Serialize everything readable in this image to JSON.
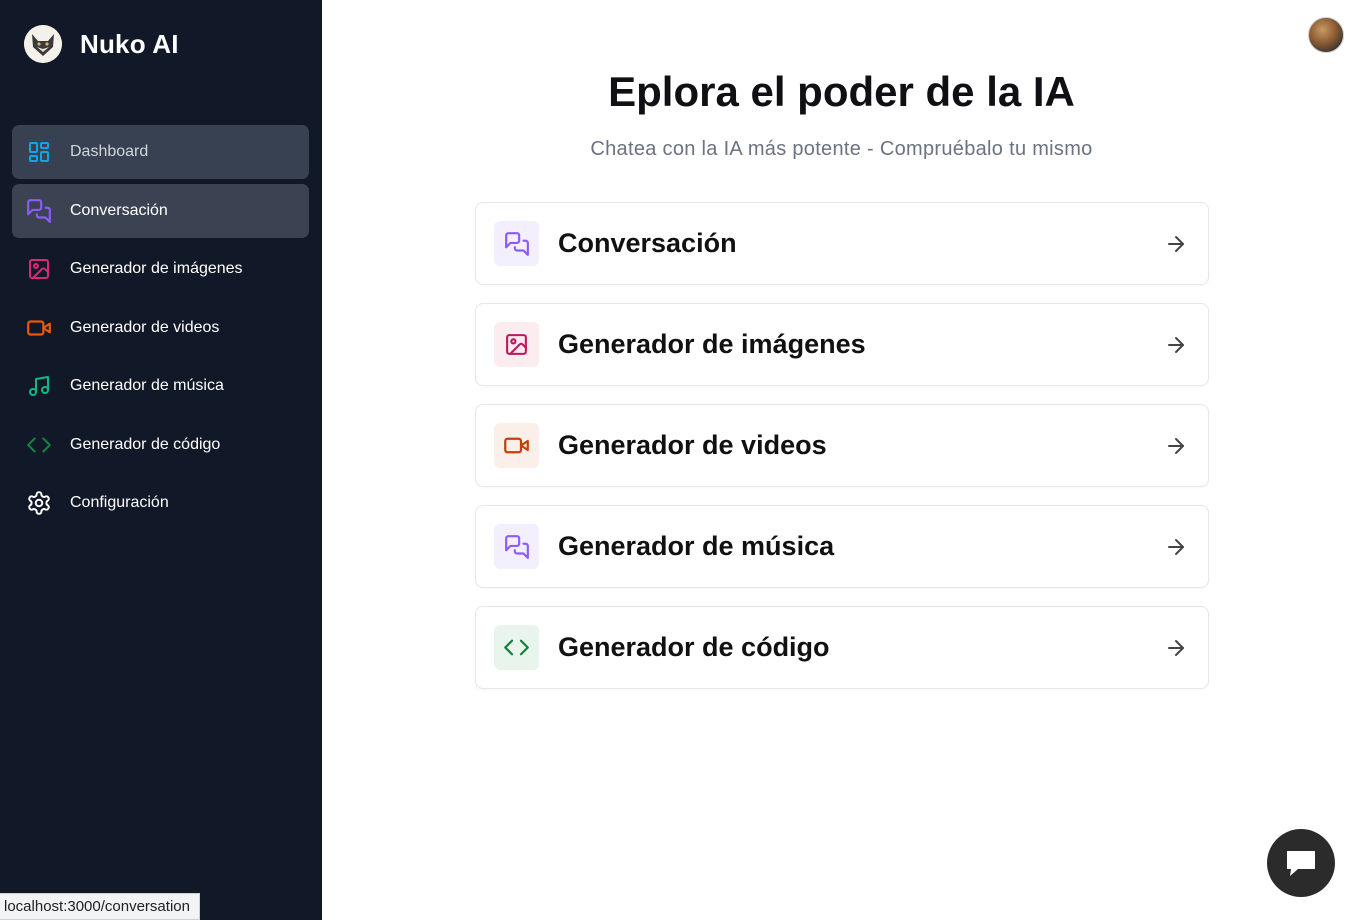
{
  "app": {
    "name": "Nuko AI"
  },
  "sidebar": {
    "items": [
      {
        "label": "Dashboard",
        "icon": "dashboard-icon",
        "color": "#0ea5e9"
      },
      {
        "label": "Conversación",
        "icon": "message-square-icon",
        "color": "#8b5cf6"
      },
      {
        "label": "Generador de imágenes",
        "icon": "image-icon",
        "color": "#db2777"
      },
      {
        "label": "Generador de videos",
        "icon": "video-icon",
        "color": "#ea580c"
      },
      {
        "label": "Generador de música",
        "icon": "music-icon",
        "color": "#10b981"
      },
      {
        "label": "Generador de código",
        "icon": "code-icon",
        "color": "#15803d"
      },
      {
        "label": "Configuración",
        "icon": "settings-icon",
        "color": "#ffffff"
      }
    ]
  },
  "main": {
    "title": "Eplora el poder de la IA",
    "subtitle": "Chatea con la IA más potente - Compruébalo tu mismo",
    "cards": [
      {
        "label": "Conversación",
        "icon": "message-square-icon",
        "color": "#8b5cf6",
        "bg": "#f3efff"
      },
      {
        "label": "Generador de imágenes",
        "icon": "image-icon",
        "color": "#be185d",
        "bg": "#fbecef"
      },
      {
        "label": "Generador de videos",
        "icon": "video-icon",
        "color": "#c2410c",
        "bg": "#fbefe9"
      },
      {
        "label": "Generador de música",
        "icon": "message-square-icon",
        "color": "#8b5cf6",
        "bg": "#f3efff"
      },
      {
        "label": "Generador de código",
        "icon": "code-icon",
        "color": "#15803d",
        "bg": "#e8f4ec"
      }
    ]
  },
  "status_bar": {
    "url": "localhost:3000/conversation"
  }
}
